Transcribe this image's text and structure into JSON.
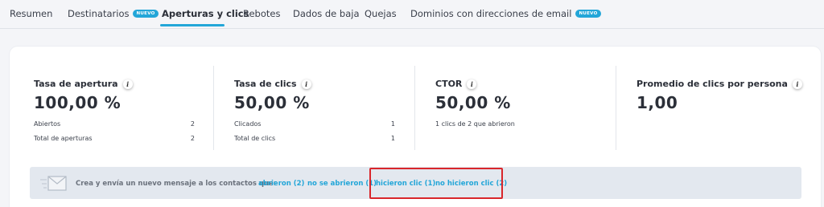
{
  "tabs": [
    {
      "label": "Resumen",
      "badge": ""
    },
    {
      "label": "Destinatarios",
      "badge": "NUEVO"
    },
    {
      "label": "Aperturas y clics",
      "badge": ""
    },
    {
      "label": "Rebotes",
      "badge": ""
    },
    {
      "label": "Dados de baja",
      "badge": ""
    },
    {
      "label": "Quejas",
      "badge": ""
    },
    {
      "label": "Dominios con direcciones de email",
      "badge": "NUEVO"
    }
  ],
  "active_tab": "Aperturas y clics",
  "stats": [
    {
      "title": "Tasa de apertura",
      "value": "100,00 %",
      "rows": [
        {
          "label": "Abiertos",
          "value": "2"
        },
        {
          "label": "Total de aperturas",
          "value": "2"
        }
      ]
    },
    {
      "title": "Tasa de clics",
      "value": "50,00 %",
      "rows": [
        {
          "label": "Clicados",
          "value": "1"
        },
        {
          "label": "Total de clics",
          "value": "1"
        }
      ]
    },
    {
      "title": "CTOR",
      "value": "50,00 %",
      "note": "1 clics de 2 que abrieron"
    },
    {
      "title": "Promedio de clics por persona",
      "value": "1,00"
    }
  ],
  "banner": {
    "text": "Crea y envía un nuevo mensaje a los contactos que:",
    "links": [
      "abrieron (2)",
      "no se abrieron (1)",
      "hicieron clic (1)",
      "no hicieron clic (2)"
    ]
  },
  "colors": {
    "accent": "#23a6d8",
    "highlight": "#d9262b",
    "banner_bg": "#e3e8ef"
  },
  "info_icon_glyph": "i"
}
